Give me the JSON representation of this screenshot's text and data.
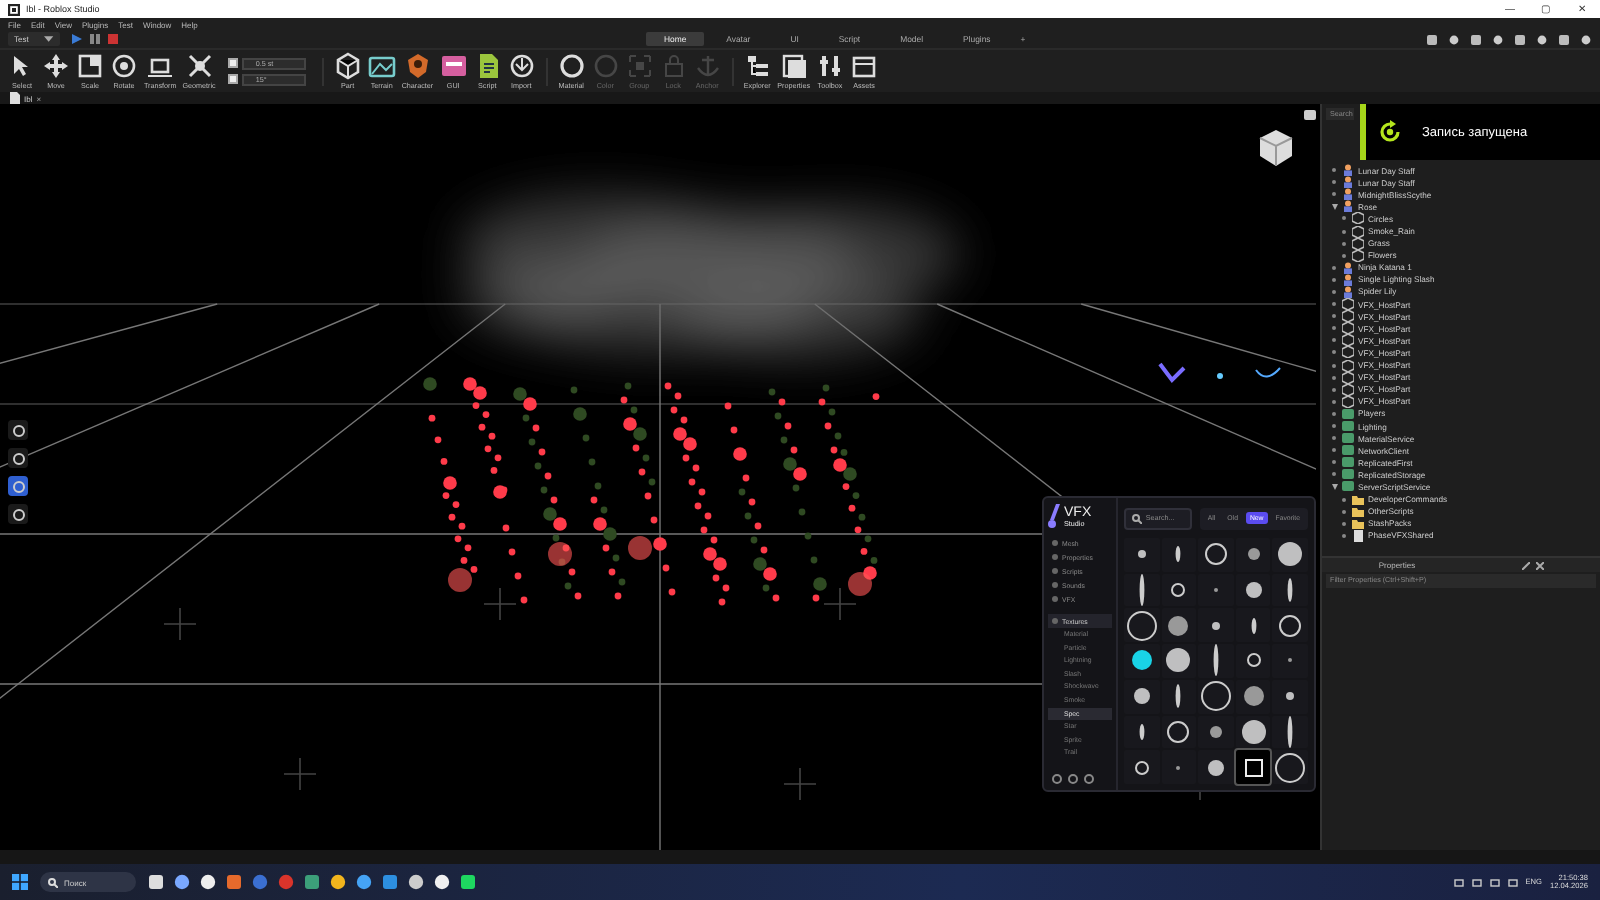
{
  "window": {
    "title": "Ibl - Roblox Studio",
    "controls": [
      "—",
      "▢",
      "✕"
    ]
  },
  "menu": [
    "File",
    "Edit",
    "View",
    "Plugins",
    "Test",
    "Window",
    "Help"
  ],
  "mode_dropdown": {
    "value": "Test"
  },
  "ribbon_tabs": [
    {
      "label": "Home",
      "selected": true
    },
    {
      "label": "Avatar",
      "selected": false
    },
    {
      "label": "UI",
      "selected": false
    },
    {
      "label": "Script",
      "selected": false
    },
    {
      "label": "Model",
      "selected": false
    },
    {
      "label": "Plugins",
      "selected": false
    }
  ],
  "add_tab": "+",
  "tools": [
    {
      "label": "Select",
      "disabled": false
    },
    {
      "label": "Move",
      "disabled": false
    },
    {
      "label": "Scale",
      "disabled": false
    },
    {
      "label": "Rotate",
      "disabled": false
    },
    {
      "label": "Transform",
      "disabled": false
    },
    {
      "label": "Geometric",
      "disabled": false
    }
  ],
  "snap_fields": [
    {
      "value": "0.5 st",
      "checked": true
    },
    {
      "value": "15°",
      "checked": true
    }
  ],
  "tools_2": [
    {
      "label": "Part",
      "disabled": false
    },
    {
      "label": "Terrain",
      "disabled": false
    },
    {
      "label": "Character",
      "disabled": false
    },
    {
      "label": "GUI",
      "disabled": false
    },
    {
      "label": "Script",
      "disabled": false
    },
    {
      "label": "Import",
      "disabled": false
    },
    {
      "label": "Material",
      "disabled": false
    },
    {
      "label": "Color",
      "disabled": true
    },
    {
      "label": "Group",
      "disabled": true
    },
    {
      "label": "Lock",
      "disabled": true
    },
    {
      "label": "Anchor",
      "disabled": true
    },
    {
      "label": "Explorer",
      "disabled": false
    },
    {
      "label": "Properties",
      "disabled": false
    },
    {
      "label": "Toolbox",
      "disabled": false
    },
    {
      "label": "Assets",
      "disabled": false
    }
  ],
  "doc_tab": {
    "label": "Ibl",
    "close": "×"
  },
  "notification": {
    "text": "Запись запущена"
  },
  "explorer": {
    "search": "Search",
    "items": [
      {
        "label": "Lunar Day Staff",
        "kind": "model"
      },
      {
        "label": "Lunar Day Staff",
        "kind": "model"
      },
      {
        "label": "MidnightBlissScythe",
        "kind": "model"
      },
      {
        "label": "Rose",
        "kind": "model",
        "expanded": true,
        "children": [
          {
            "label": "Circles",
            "kind": "effect"
          },
          {
            "label": "Smoke_Rain",
            "kind": "effect"
          },
          {
            "label": "Grass",
            "kind": "effect"
          },
          {
            "label": "Flowers",
            "kind": "effect"
          }
        ]
      },
      {
        "label": "Ninja Katana 1",
        "kind": "model"
      },
      {
        "label": "Single Lighting Slash",
        "kind": "model"
      },
      {
        "label": "Spider Lily",
        "kind": "model"
      },
      {
        "label": "VFX_HostPart",
        "kind": "effect"
      },
      {
        "label": "VFX_HostPart",
        "kind": "effect"
      },
      {
        "label": "VFX_HostPart",
        "kind": "effect"
      },
      {
        "label": "VFX_HostPart",
        "kind": "effect"
      },
      {
        "label": "VFX_HostPart",
        "kind": "effect"
      },
      {
        "label": "VFX_HostPart",
        "kind": "effect"
      },
      {
        "label": "VFX_HostPart",
        "kind": "effect"
      },
      {
        "label": "VFX_HostPart",
        "kind": "effect"
      },
      {
        "label": "VFX_HostPart",
        "kind": "effect"
      },
      {
        "label": "Players",
        "kind": "service"
      },
      {
        "label": "Lighting",
        "kind": "service"
      },
      {
        "label": "MaterialService",
        "kind": "service"
      },
      {
        "label": "NetworkClient",
        "kind": "service"
      },
      {
        "label": "ReplicatedFirst",
        "kind": "service"
      },
      {
        "label": "ReplicatedStorage",
        "kind": "service"
      },
      {
        "label": "ServerScriptService",
        "kind": "service",
        "expanded": true,
        "children": [
          {
            "label": "DeveloperCommands",
            "kind": "folder"
          },
          {
            "label": "OtherScripts",
            "kind": "folder"
          },
          {
            "label": "StashPacks",
            "kind": "folder"
          },
          {
            "label": "PhaseVFXShared",
            "kind": "script"
          }
        ]
      }
    ]
  },
  "properties": {
    "title": "Properties",
    "filter_placeholder": "Filter Properties (Ctrl+Shift+P)"
  },
  "vfx_panel": {
    "logo": "VFX",
    "logo_sub": "Studio",
    "search_placeholder": "Search...",
    "filters": [
      {
        "label": "All",
        "selected": false
      },
      {
        "label": "Old",
        "selected": false
      },
      {
        "label": "New",
        "selected": true
      },
      {
        "label": "Favorite",
        "selected": false
      }
    ],
    "nav": [
      {
        "label": "Mesh",
        "selected": false
      },
      {
        "label": "Properties",
        "selected": false
      },
      {
        "label": "Scripts",
        "selected": false
      },
      {
        "label": "Sounds",
        "selected": false
      },
      {
        "label": "VFX",
        "selected": false
      },
      {
        "label": "Textures",
        "selected": false,
        "expanded": true,
        "children": [
          {
            "label": "Material",
            "selected": false
          },
          {
            "label": "Particle",
            "selected": false
          },
          {
            "label": "Lightning",
            "selected": false
          },
          {
            "label": "Slash",
            "selected": false
          },
          {
            "label": "Shockwave",
            "selected": false
          },
          {
            "label": "Smoke",
            "selected": false
          },
          {
            "label": "Spec",
            "selected": true
          },
          {
            "label": "Star",
            "selected": false
          },
          {
            "label": "Sprite",
            "selected": false
          },
          {
            "label": "Trail",
            "selected": false
          }
        ]
      }
    ],
    "textures": [
      {
        "selected": false
      },
      {
        "selected": false
      },
      {
        "selected": false
      },
      {
        "selected": false
      },
      {
        "selected": false
      },
      {
        "selected": false
      },
      {
        "selected": false
      },
      {
        "selected": false
      },
      {
        "selected": false
      },
      {
        "selected": false
      },
      {
        "selected": false
      },
      {
        "selected": false
      },
      {
        "selected": false
      },
      {
        "selected": false
      },
      {
        "selected": false
      },
      {
        "selected": false
      },
      {
        "selected": false
      },
      {
        "selected": false
      },
      {
        "selected": false
      },
      {
        "selected": false
      },
      {
        "selected": false
      },
      {
        "selected": false
      },
      {
        "selected": false
      },
      {
        "selected": false
      },
      {
        "selected": false
      },
      {
        "selected": false
      },
      {
        "selected": false
      },
      {
        "selected": false
      },
      {
        "selected": false
      },
      {
        "selected": false
      },
      {
        "selected": false
      },
      {
        "selected": false
      },
      {
        "selected": false
      },
      {
        "selected": true
      },
      {
        "selected": false
      }
    ]
  },
  "taskbar": {
    "search": "Поиск",
    "language": "ENG",
    "time": "21:50:38",
    "date": "12.04.2026"
  }
}
